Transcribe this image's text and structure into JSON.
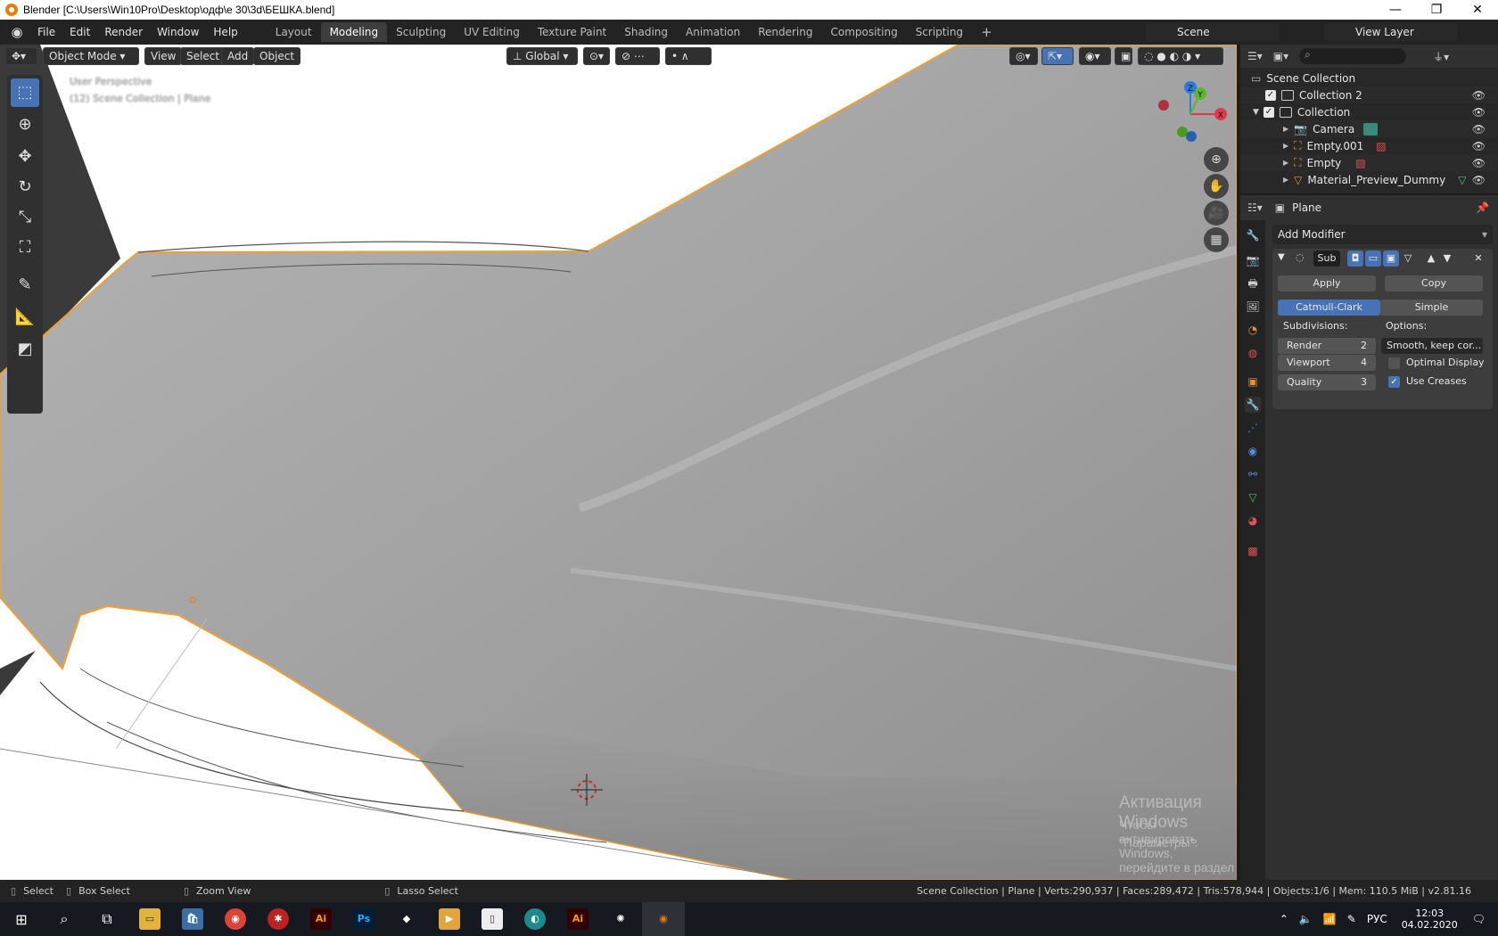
{
  "window": {
    "title": "Blender [C:\\Users\\Win10Pro\\Desktop\\одф\\е 30\\3d\\БЕШКА.blend]",
    "controls": [
      "—",
      "❐",
      "✕"
    ]
  },
  "menu": {
    "items": [
      "File",
      "Edit",
      "Render",
      "Window",
      "Help"
    ],
    "workspaces": [
      "Layout",
      "Modeling",
      "Sculpting",
      "UV Editing",
      "Texture Paint",
      "Shading",
      "Animation",
      "Rendering",
      "Compositing",
      "Scripting"
    ],
    "active_workspace": "Modeling",
    "plus": "+",
    "scene": "Scene",
    "view_layer": "View Layer"
  },
  "viewport": {
    "mode": "Object Mode",
    "header_menus": [
      "View",
      "Select",
      "Add",
      "Object"
    ],
    "transform_orientation": "Global",
    "overlay_line1": "User Perspective",
    "overlay_line2": "(12) Scene Collection | Plane",
    "gizmo_axes": [
      "Z",
      "Y",
      "X"
    ],
    "watermark_title": "Активация Windows",
    "watermark_line1": "Чтобы активировать Windows, перейдите в раздел",
    "watermark_line2": "\"Параметры\"."
  },
  "outliner": {
    "root": "Scene Collection",
    "rows": [
      {
        "label": "Collection 2",
        "type": "collection"
      },
      {
        "label": "Collection",
        "type": "collection"
      },
      {
        "label": "Camera",
        "type": "camera"
      },
      {
        "label": "Empty.001",
        "type": "empty"
      },
      {
        "label": "Empty",
        "type": "empty"
      },
      {
        "label": "Material_Preview_Dummy",
        "type": "mesh"
      }
    ]
  },
  "properties": {
    "object_name": "Plane",
    "add_modifier": "Add Modifier",
    "modifier_name": "Sub",
    "apply": "Apply",
    "copy": "Copy",
    "catmull": "Catmull-Clark",
    "simple": "Simple",
    "subdivisions_label": "Subdivisions:",
    "options_label": "Options:",
    "render_label": "Render",
    "render_value": "2",
    "viewport_label": "Viewport",
    "viewport_value": "4",
    "quality_label": "Quality",
    "quality_value": "3",
    "uv_smooth": "Smooth, keep cor...",
    "optimal_display": "Optimal Display",
    "use_creases": "Use Creases"
  },
  "status": {
    "select": "Select",
    "box_select": "Box Select",
    "zoom_view": "Zoom View",
    "lasso_select": "Lasso Select",
    "stats": "Scene Collection | Plane | Verts:290,937 | Faces:289,472 | Tris:578,944 | Objects:1/6 | Mem: 110.5 MiB | v2.81.16"
  },
  "taskbar": {
    "lang": "РУС",
    "time": "12:03",
    "date": "04.02.2020"
  },
  "colors": {
    "accent": "#4772b3",
    "selection_outline": "#f0a030",
    "brand_orange": "#e87d0d"
  }
}
